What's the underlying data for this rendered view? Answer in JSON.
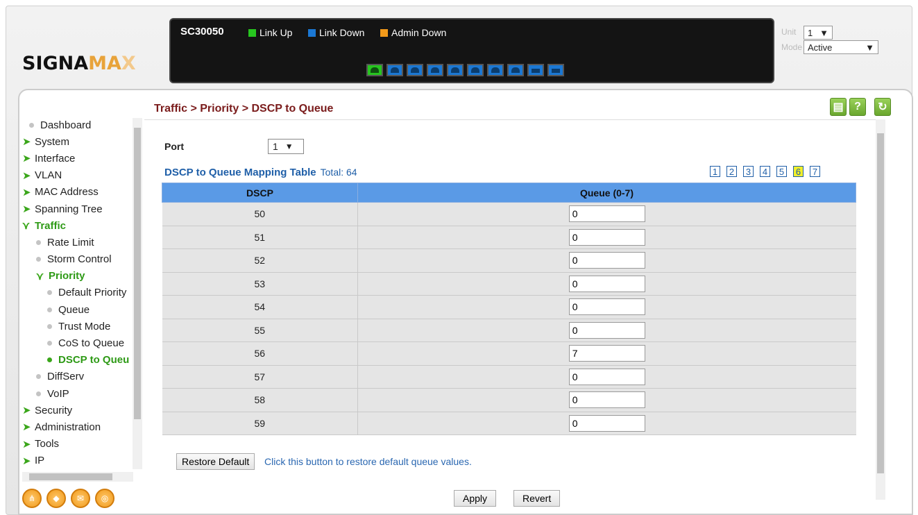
{
  "brand": {
    "logo_text_a": "SIGNA",
    "logo_text_b": "MA",
    "logo_text_c": "X"
  },
  "panel": {
    "model": "SC30050",
    "legend": [
      {
        "label": "Link Up",
        "color": "#27c61f"
      },
      {
        "label": "Link Down",
        "color": "#1b78d4"
      },
      {
        "label": "Admin Down",
        "color": "#f39a1a"
      }
    ],
    "unit_label": "Unit",
    "unit_value": "1",
    "mode_label": "Mode",
    "mode_value": "Active"
  },
  "breadcrumb": "Traffic > Priority > DSCP to Queue",
  "toolbar": {
    "save_icon": "save-icon",
    "help_label": "?",
    "refresh_icon": "refresh-icon"
  },
  "sidebar": {
    "items": [
      {
        "label": "Dashboard"
      },
      {
        "label": "System"
      },
      {
        "label": "Interface"
      },
      {
        "label": "VLAN"
      },
      {
        "label": "MAC Address"
      },
      {
        "label": "Spanning Tree"
      },
      {
        "label": "Traffic"
      },
      {
        "label": "Rate Limit"
      },
      {
        "label": "Storm Control"
      },
      {
        "label": "Priority"
      },
      {
        "label": "Default Priority"
      },
      {
        "label": "Queue"
      },
      {
        "label": "Trust Mode"
      },
      {
        "label": "CoS to Queue"
      },
      {
        "label": "DSCP to Queu"
      },
      {
        "label": "DiffServ"
      },
      {
        "label": "VoIP"
      },
      {
        "label": "Security"
      },
      {
        "label": "Administration"
      },
      {
        "label": "Tools"
      },
      {
        "label": "IP"
      }
    ]
  },
  "form": {
    "port_label": "Port",
    "port_value": "1",
    "table_title": "DSCP to Queue Mapping Table",
    "total_text": "Total: 64",
    "pages": [
      "1",
      "2",
      "3",
      "4",
      "5",
      "6",
      "7"
    ],
    "current_page": "6",
    "columns": [
      "DSCP",
      "Queue (0-7)"
    ],
    "rows": [
      {
        "dscp": "50",
        "queue": "0"
      },
      {
        "dscp": "51",
        "queue": "0"
      },
      {
        "dscp": "52",
        "queue": "0"
      },
      {
        "dscp": "53",
        "queue": "0"
      },
      {
        "dscp": "54",
        "queue": "0"
      },
      {
        "dscp": "55",
        "queue": "0"
      },
      {
        "dscp": "56",
        "queue": "7"
      },
      {
        "dscp": "57",
        "queue": "0"
      },
      {
        "dscp": "58",
        "queue": "0"
      },
      {
        "dscp": "59",
        "queue": "0"
      }
    ],
    "restore_label": "Restore Default",
    "restore_note": "Click this button to restore default queue values.",
    "apply_label": "Apply",
    "revert_label": "Revert"
  }
}
